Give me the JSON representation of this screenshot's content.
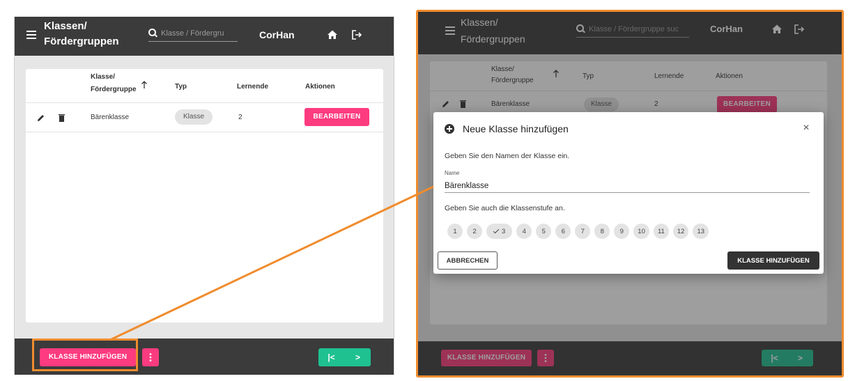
{
  "app": {
    "title_line1": "Klassen/",
    "title_line2": "Fördergruppen",
    "search_placeholder_left": "Klasse / Fördergru",
    "search_placeholder_right": "Klasse / Fördergruppe suc",
    "user": "CorHan"
  },
  "table": {
    "headers": {
      "klasse_line1": "Klasse/",
      "klasse_line2": "Fördergruppe",
      "sort_icon": "arrow-up",
      "typ": "Typ",
      "lernende": "Lernende",
      "aktionen": "Aktionen"
    },
    "rows": [
      {
        "name": "Bärenklasse",
        "typ": "Klasse",
        "lernende": "2",
        "action": "BEARBEITEN"
      }
    ]
  },
  "bottom": {
    "add_label": "KLASSE HINZUFÜGEN",
    "more_icon": "more-vert",
    "first_label": "|<",
    "next_label": ">"
  },
  "dialog": {
    "title": "Neue Klasse hinzufügen",
    "close": "×",
    "instruction_name": "Geben Sie den Namen der Klasse ein.",
    "name_label": "Name",
    "name_value": "Bärenklasse",
    "instruction_level": "Geben Sie auch die Klassenstufe an.",
    "levels": [
      "1",
      "2",
      "3",
      "4",
      "5",
      "6",
      "7",
      "8",
      "9",
      "10",
      "11",
      "12",
      "13"
    ],
    "selected_level": "3",
    "cancel_label": "ABBRECHEN",
    "add_label": "KLASSE HINZUFÜGEN"
  },
  "colors": {
    "accent_pink": "#fd3b7f",
    "nav_green": "#1fc191",
    "bar_dark": "#3b3b3b",
    "highlight_orange": "#f08c2e"
  }
}
